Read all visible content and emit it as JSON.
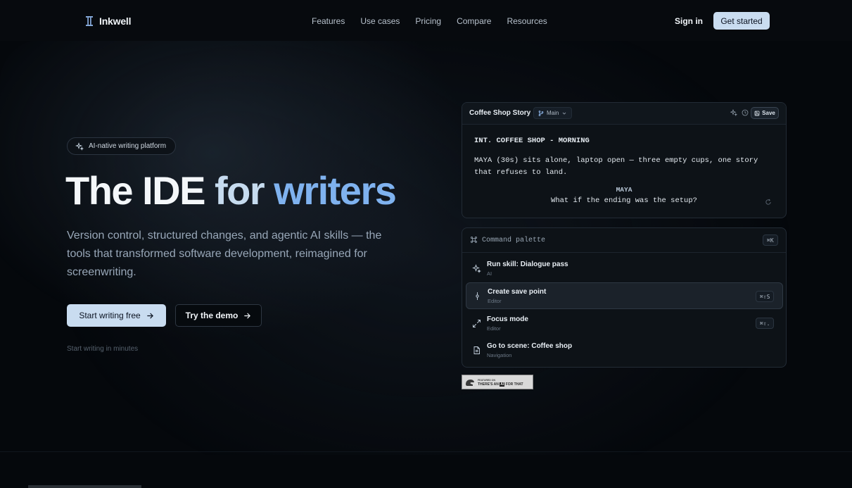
{
  "nav": {
    "brand": "Inkwell",
    "links": [
      "Features",
      "Use cases",
      "Pricing",
      "Compare",
      "Resources"
    ],
    "sign_in": "Sign in",
    "get_started": "Get started"
  },
  "hero": {
    "badge": "AI-native writing platform",
    "title_part1": "The IDE",
    "title_part2": "for",
    "title_part3": "writers",
    "subtitle": "Version control, structured changes, and agentic AI skills — the tools that transformed software development, reimagined for screenwriting.",
    "primary_cta": "Start writing free",
    "secondary_cta": "Try the demo",
    "hint": "Start writing in minutes"
  },
  "editor": {
    "title": "Coffee Shop Story",
    "branch": "Main",
    "save": "Save",
    "scene_heading": "INT. COFFEE SHOP - MORNING",
    "action": "MAYA (30s) sits alone, laptop open — three empty cups, one story that refuses to land.",
    "character": "MAYA",
    "dialogue": "What if the ending was the setup?"
  },
  "palette": {
    "title": "Command palette",
    "shortcut": "⌘K",
    "items": [
      {
        "name": "Run skill: Dialogue pass",
        "category": "AI",
        "shortcut": ""
      },
      {
        "name": "Create save point",
        "category": "Editor",
        "shortcut": "⌘⇧S"
      },
      {
        "name": "Focus mode",
        "category": "Editor",
        "shortcut": "⌘⇧."
      },
      {
        "name": "Go to scene: Coffee shop",
        "category": "Navigation",
        "shortcut": ""
      }
    ]
  },
  "sponsor": {
    "small": "FEATURED ON",
    "text_before": "THERE'S AN",
    "text_ai": "AI",
    "text_after": "FOR THAT"
  },
  "colors": {
    "background": "#05080c",
    "accent_light": "#c9dcf0",
    "accent_blue": "#7fb2ef",
    "card": "#0d1217"
  }
}
